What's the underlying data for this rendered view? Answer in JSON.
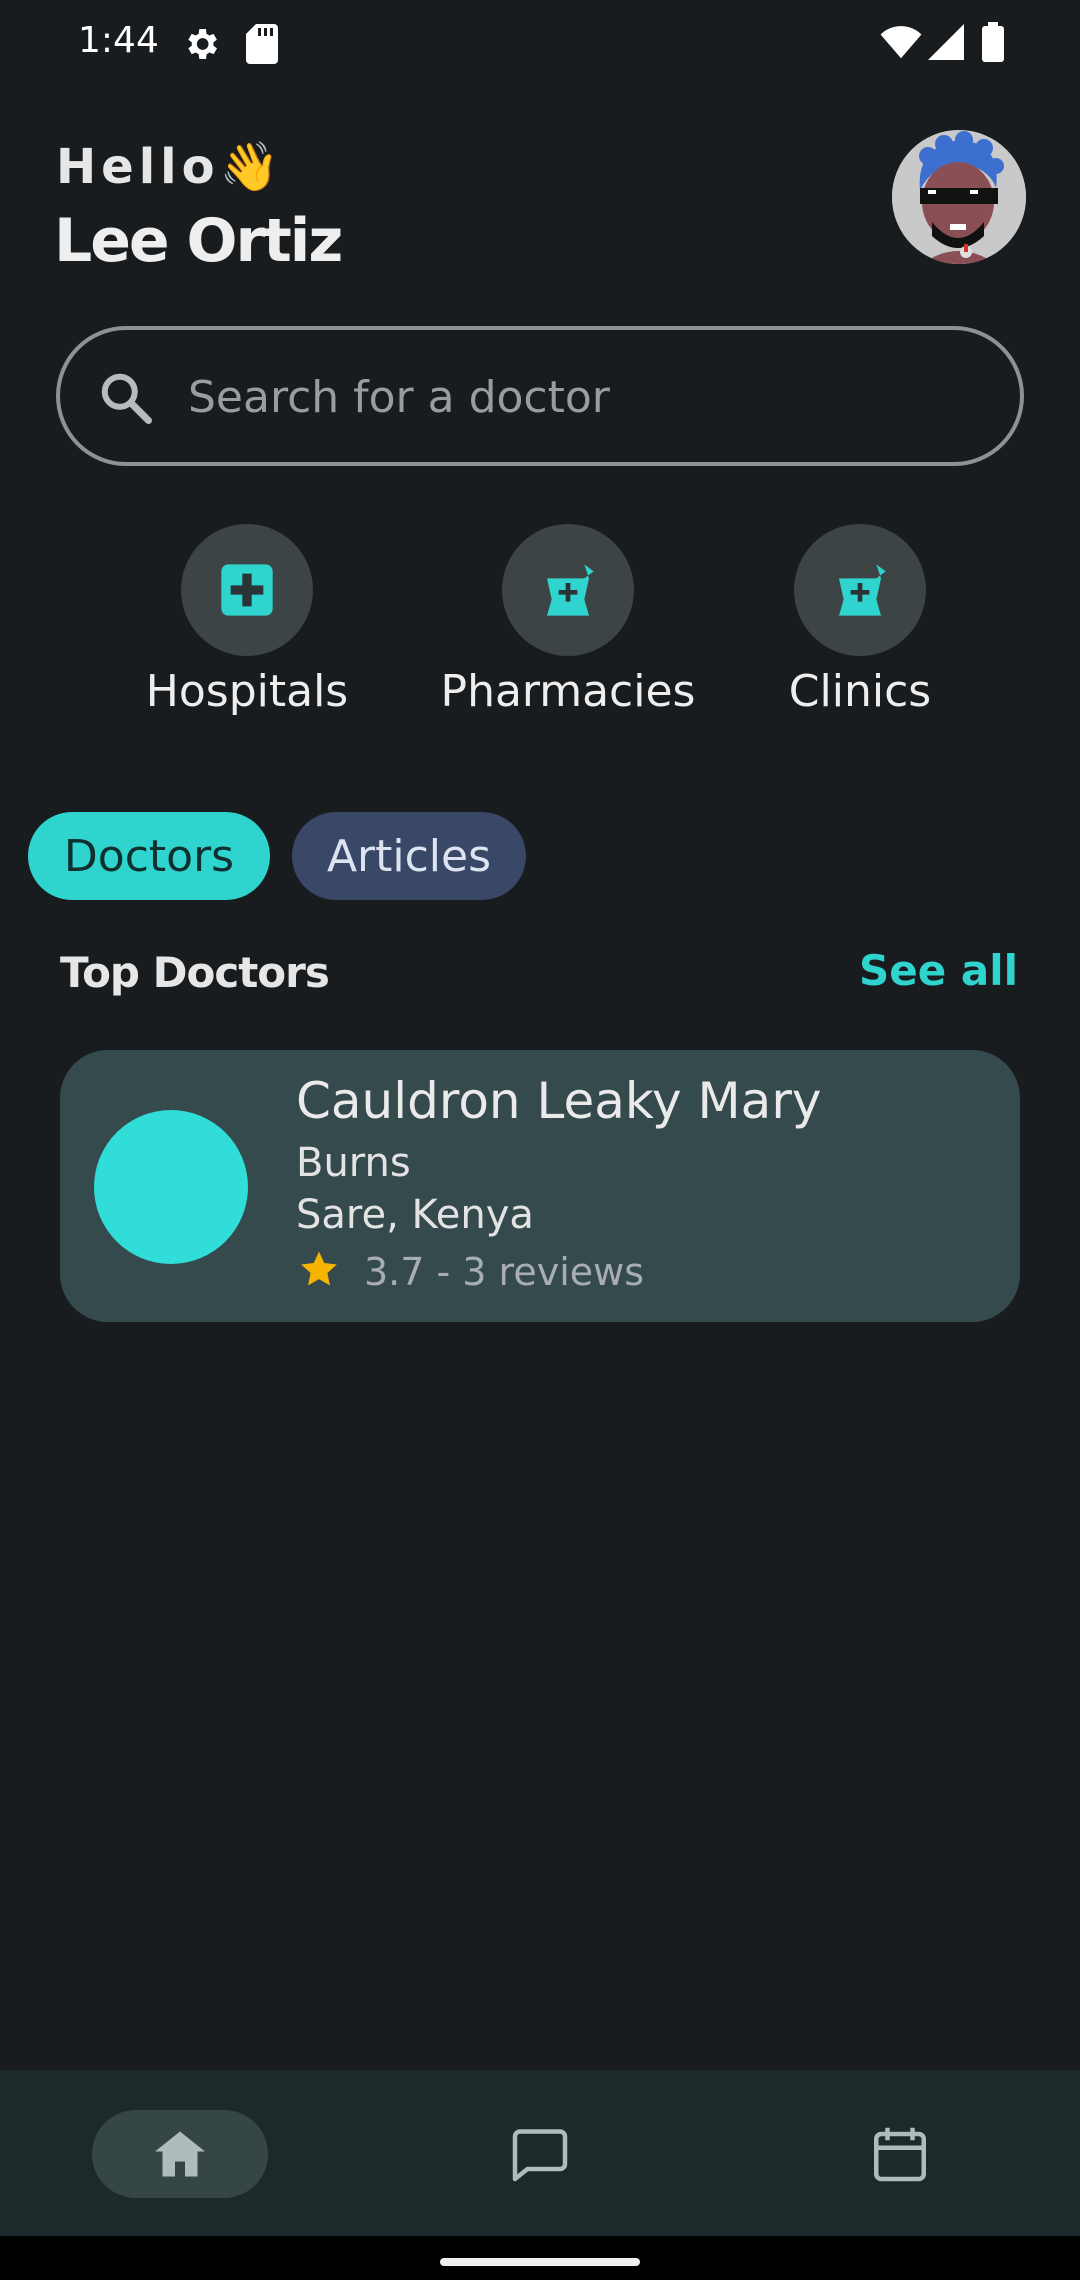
{
  "status_bar": {
    "time": "1:44",
    "icons": [
      "gear-icon",
      "sd-card-icon",
      "wifi-icon",
      "cell-signal-icon",
      "battery-icon"
    ]
  },
  "header": {
    "greeting": "Hello👋",
    "user_name": "Lee Ortiz",
    "avatar_icon": "user-avatar"
  },
  "search": {
    "placeholder": "Search for a doctor",
    "value": "",
    "icon": "search-icon"
  },
  "categories": [
    {
      "label": "Hospitals",
      "icon": "medical-cross-icon"
    },
    {
      "label": "Pharmacies",
      "icon": "mortar-pestle-icon"
    },
    {
      "label": "Clinics",
      "icon": "mortar-pestle-icon"
    }
  ],
  "tabs": [
    {
      "label": "Doctors",
      "selected": true
    },
    {
      "label": "Articles",
      "selected": false
    }
  ],
  "section": {
    "title": "Top Doctors",
    "see_all": "See all"
  },
  "doctors": [
    {
      "name": "Cauldron Leaky Mary",
      "specialty": "Burns",
      "location": "Sare, Kenya",
      "rating_text": "3.7 - 3 reviews",
      "rating": 3.7
    }
  ],
  "bottom_nav": [
    {
      "icon": "home-icon",
      "selected": true
    },
    {
      "icon": "chat-icon",
      "selected": false
    },
    {
      "icon": "calendar-icon",
      "selected": false
    }
  ],
  "colors": {
    "background": "#191c1e",
    "accent": "#2fd4cf",
    "card": "#354a4d",
    "chip_inactive": "#3a4868",
    "star": "#f6b400"
  }
}
